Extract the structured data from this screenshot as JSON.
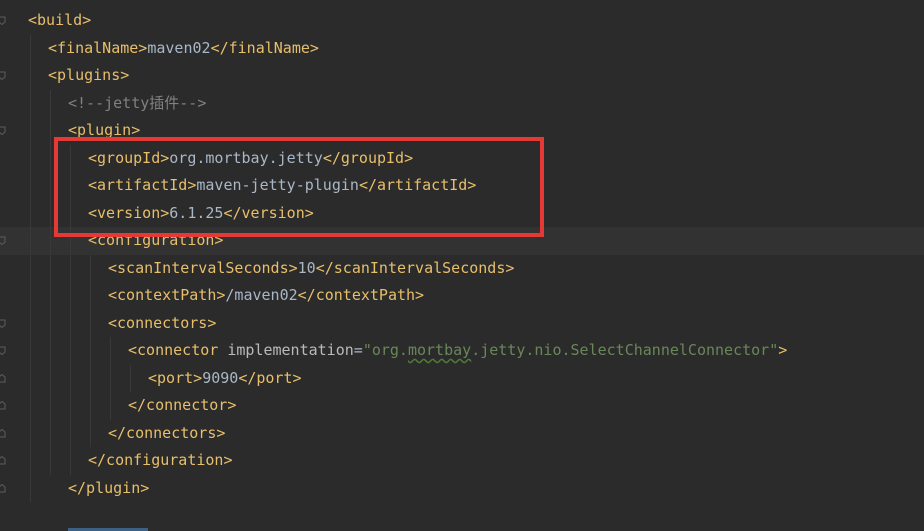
{
  "lines": [
    {
      "code": [
        {
          "t": "tag",
          "v": "<build>"
        }
      ]
    },
    {
      "code": [
        {
          "t": "tag",
          "v": "<finalName>"
        },
        {
          "t": "text",
          "v": "maven02"
        },
        {
          "t": "tag",
          "v": "</finalName>"
        }
      ]
    },
    {
      "code": [
        {
          "t": "tag",
          "v": "<plugins>"
        }
      ]
    },
    {
      "code": [
        {
          "t": "comment",
          "v": "<!--jetty插件-->"
        }
      ]
    },
    {
      "code": [
        {
          "t": "tag",
          "v": "<plugin>"
        }
      ]
    },
    {
      "code": [
        {
          "t": "tag",
          "v": "<groupId>"
        },
        {
          "t": "text",
          "v": "org.mortbay.jetty"
        },
        {
          "t": "tag",
          "v": "</groupId>"
        }
      ]
    },
    {
      "code": [
        {
          "t": "tag",
          "v": "<artifactId>"
        },
        {
          "t": "text",
          "v": "maven-jetty-plugin"
        },
        {
          "t": "tag",
          "v": "</artifactId>"
        }
      ]
    },
    {
      "code": [
        {
          "t": "tag",
          "v": "<version>"
        },
        {
          "t": "text",
          "v": "6.1.25"
        },
        {
          "t": "tag",
          "v": "</version>"
        }
      ]
    },
    {
      "code": [
        {
          "t": "tag",
          "v": "<configuration>"
        }
      ]
    },
    {
      "code": [
        {
          "t": "tag",
          "v": "<scanIntervalSeconds>"
        },
        {
          "t": "text",
          "v": "10"
        },
        {
          "t": "tag",
          "v": "</scanIntervalSeconds>"
        }
      ]
    },
    {
      "code": [
        {
          "t": "tag",
          "v": "<contextPath>"
        },
        {
          "t": "text",
          "v": "/maven02"
        },
        {
          "t": "tag",
          "v": "</contextPath>"
        }
      ]
    },
    {
      "code": [
        {
          "t": "tag",
          "v": "<connectors>"
        }
      ]
    },
    {
      "code": [
        {
          "t": "tag",
          "v": "<connector "
        },
        {
          "t": "attr",
          "v": "implementation"
        },
        {
          "t": "eq",
          "v": "="
        },
        {
          "t": "str",
          "v": "\"org."
        },
        {
          "t": "str typo",
          "v": "mortbay"
        },
        {
          "t": "str",
          "v": ".jetty.nio.SelectChannelConnector\""
        },
        {
          "t": "tag",
          "v": ">"
        }
      ]
    },
    {
      "code": [
        {
          "t": "tag",
          "v": "<port>"
        },
        {
          "t": "text",
          "v": "9090"
        },
        {
          "t": "tag",
          "v": "</port>"
        }
      ]
    },
    {
      "code": [
        {
          "t": "tag",
          "v": "</connector>"
        }
      ]
    },
    {
      "code": [
        {
          "t": "tag",
          "v": "</connectors>"
        }
      ]
    },
    {
      "code": [
        {
          "t": "tag",
          "v": "</configuration>"
        }
      ]
    },
    {
      "code": [
        {
          "t": "tag",
          "v": "</plugin>"
        }
      ]
    }
  ],
  "highlight": {
    "color": "#e53935"
  },
  "colors": {
    "background": "#2b2b2b",
    "tag": "#e8bf6a",
    "text": "#a9b7c6",
    "comment": "#808080",
    "string": "#6a8759"
  },
  "gutter_icons": [
    "fold-open-icon",
    "fold-open-icon",
    "fold-open-icon",
    "fold-open-icon",
    "fold-open-icon",
    "fold-open-icon",
    "fold-open-icon",
    "fold-end-icon",
    "fold-end-icon",
    "fold-end-icon",
    "fold-end-icon",
    "fold-end-icon"
  ]
}
